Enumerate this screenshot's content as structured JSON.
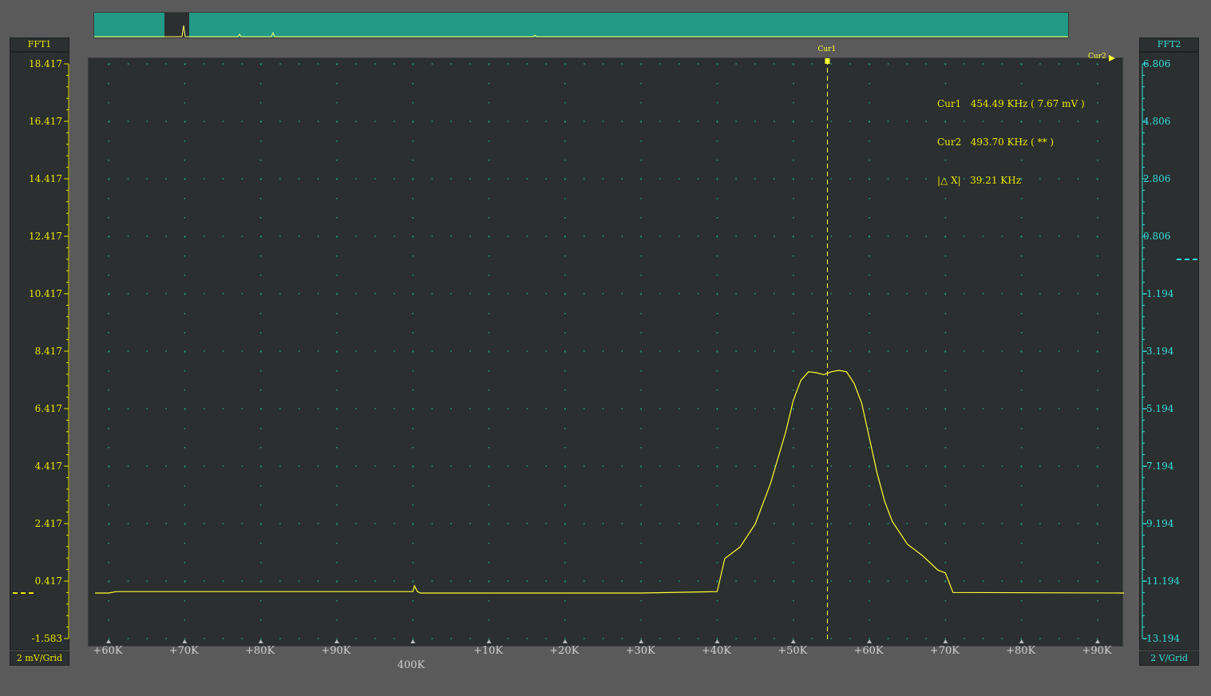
{
  "colors": {
    "trace": "#ffff33",
    "grid": "#1fa08a",
    "left_axis": "#e8e800",
    "right_axis": "#33dddd",
    "overview": "#219a86"
  },
  "left_panel": {
    "title": "FFT1",
    "scale": "2 mV/Grid",
    "ticks": [
      "18.417",
      "16.417",
      "14.417",
      "12.417",
      "10.417",
      "8.417",
      "6.417",
      "4.417",
      "2.417",
      "0.417",
      "-1.583"
    ]
  },
  "right_panel": {
    "title": "FFT2",
    "scale": "2 V/Grid",
    "ticks": [
      "6.806",
      "4.806",
      "2.806",
      "0.806",
      "-1.194",
      "-3.194",
      "-5.194",
      "-7.194",
      "-9.194",
      "-11.194",
      "-13.194"
    ]
  },
  "cursors": {
    "cur1_label": "Cur1",
    "cur2_label": "Cur2",
    "cur1_line": "Cur1   454.49 KHz ( 7.67 mV )",
    "cur2_line": "Cur2   493.70 KHz ( ** )",
    "delta_line": "|△ X|   39.21 KHz"
  },
  "x_axis": {
    "ticks": [
      "+60K",
      "+70K",
      "+80K",
      "+90K",
      "",
      "+10K",
      "+20K",
      "+30K",
      "+40K",
      "+50K",
      "+60K",
      "+70K",
      "+80K",
      "+90K"
    ],
    "center_label": "400K"
  },
  "chart_data": {
    "type": "line",
    "xlabel": "",
    "ylabel": "",
    "xlim": [
      360,
      496
    ],
    "ylim": [
      -1.583,
      18.417
    ],
    "x_unit": "KHz",
    "y_unit": "mV",
    "grid": true,
    "series": [
      {
        "x": [
          360,
          361,
          400,
          400.2,
          400.6,
          401,
          430,
          440,
          441,
          443,
          445,
          447,
          449,
          450,
          451,
          452,
          453,
          454,
          455,
          456,
          457,
          458,
          459,
          460,
          461,
          462,
          463,
          465,
          467,
          469,
          470,
          471,
          494
        ],
        "y": [
          0.0,
          0.05,
          0.05,
          0.25,
          0.05,
          0.0,
          0.0,
          0.05,
          1.2,
          1.6,
          2.4,
          3.8,
          5.6,
          6.7,
          7.4,
          7.7,
          7.67,
          7.6,
          7.7,
          7.75,
          7.7,
          7.3,
          6.6,
          5.4,
          4.2,
          3.2,
          2.5,
          1.7,
          1.3,
          0.8,
          0.7,
          0.02,
          0.0
        ]
      }
    ],
    "cursor1_x": 454.49,
    "cursor2_x": 493.7
  }
}
